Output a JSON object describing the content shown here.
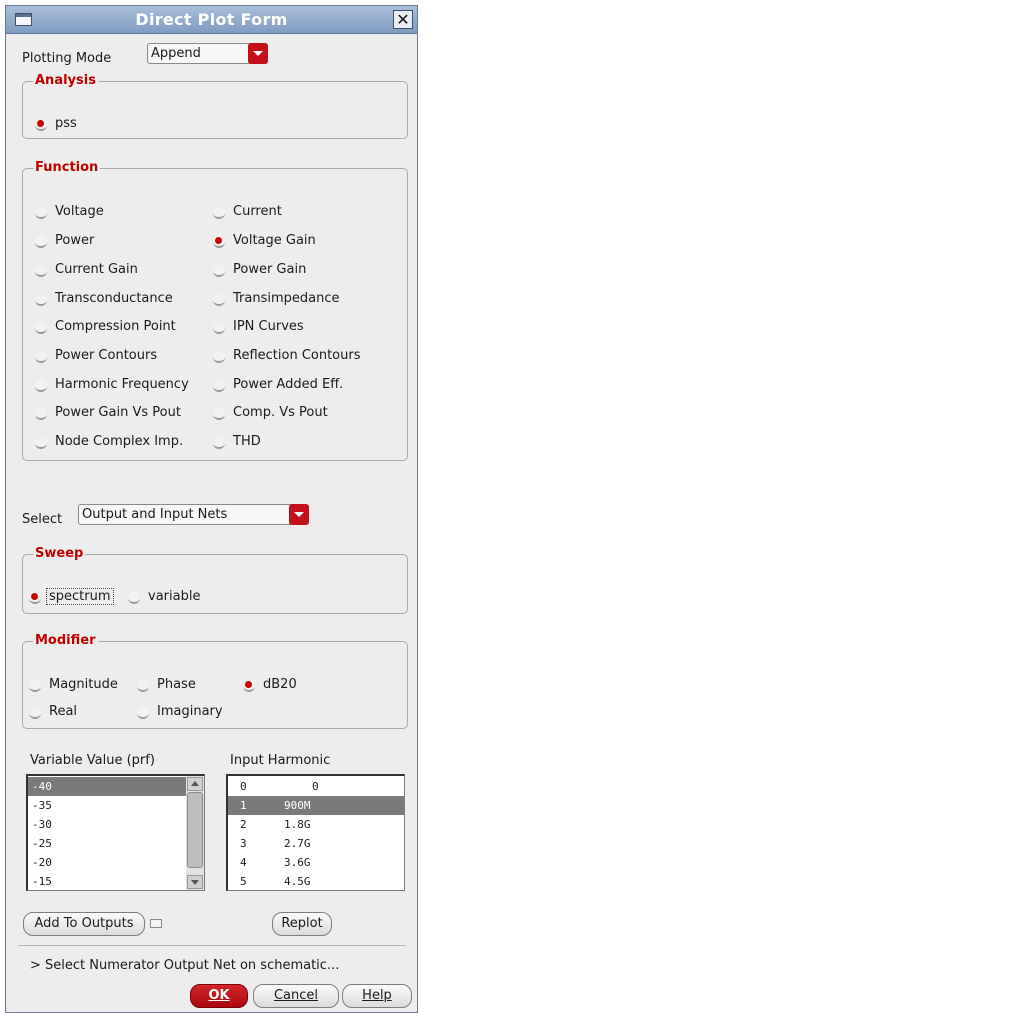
{
  "window": {
    "title": "Direct Plot Form"
  },
  "plotting_mode": {
    "label": "Plotting Mode",
    "value": "Append"
  },
  "analysis": {
    "title": "Analysis",
    "options": [
      {
        "label": "pss",
        "selected": true
      }
    ]
  },
  "function": {
    "title": "Function",
    "left": [
      {
        "label": "Voltage",
        "selected": false
      },
      {
        "label": "Power",
        "selected": false
      },
      {
        "label": "Current Gain",
        "selected": false
      },
      {
        "label": "Transconductance",
        "selected": false
      },
      {
        "label": "Compression Point",
        "selected": false
      },
      {
        "label": "Power Contours",
        "selected": false
      },
      {
        "label": "Harmonic Frequency",
        "selected": false
      },
      {
        "label": "Power Gain Vs Pout",
        "selected": false
      },
      {
        "label": "Node Complex Imp.",
        "selected": false
      }
    ],
    "right": [
      {
        "label": "Current",
        "selected": false
      },
      {
        "label": "Voltage Gain",
        "selected": true
      },
      {
        "label": "Power Gain",
        "selected": false
      },
      {
        "label": "Transimpedance",
        "selected": false
      },
      {
        "label": "IPN Curves",
        "selected": false
      },
      {
        "label": "Reflection Contours",
        "selected": false
      },
      {
        "label": "Power Added Eff.",
        "selected": false
      },
      {
        "label": "Comp. Vs Pout",
        "selected": false
      },
      {
        "label": "THD",
        "selected": false
      }
    ]
  },
  "select": {
    "label": "Select",
    "value": "Output and Input Nets"
  },
  "sweep": {
    "title": "Sweep",
    "options": [
      {
        "label": "spectrum",
        "selected": true
      },
      {
        "label": "variable",
        "selected": false
      }
    ]
  },
  "modifier": {
    "title": "Modifier",
    "options": [
      {
        "label": "Magnitude",
        "selected": false
      },
      {
        "label": "Phase",
        "selected": false
      },
      {
        "label": "dB20",
        "selected": true
      },
      {
        "label": "Real",
        "selected": false
      },
      {
        "label": "Imaginary",
        "selected": false
      }
    ]
  },
  "variable_value": {
    "label": "Variable Value (prf)",
    "items": [
      "-40",
      "-35",
      "-30",
      "-25",
      "-20",
      "-15"
    ],
    "selected_index": 0
  },
  "input_harmonic": {
    "label": "Input Harmonic",
    "items": [
      {
        "index": "0",
        "freq": "0"
      },
      {
        "index": "1",
        "freq": "900M"
      },
      {
        "index": "2",
        "freq": "1.8G"
      },
      {
        "index": "3",
        "freq": "2.7G"
      },
      {
        "index": "4",
        "freq": "3.6G"
      },
      {
        "index": "5",
        "freq": "4.5G"
      }
    ],
    "selected_index": 1
  },
  "buttons": {
    "add_to_outputs": "Add To Outputs",
    "replot": "Replot",
    "ok": "OK",
    "cancel": "Cancel",
    "help": "Help"
  },
  "status": {
    "message": "> Select Numerator Output Net on schematic..."
  },
  "colors": {
    "accent": "#c4101a",
    "group_title": "#c00000",
    "titlebar": "#7f9cc2"
  }
}
